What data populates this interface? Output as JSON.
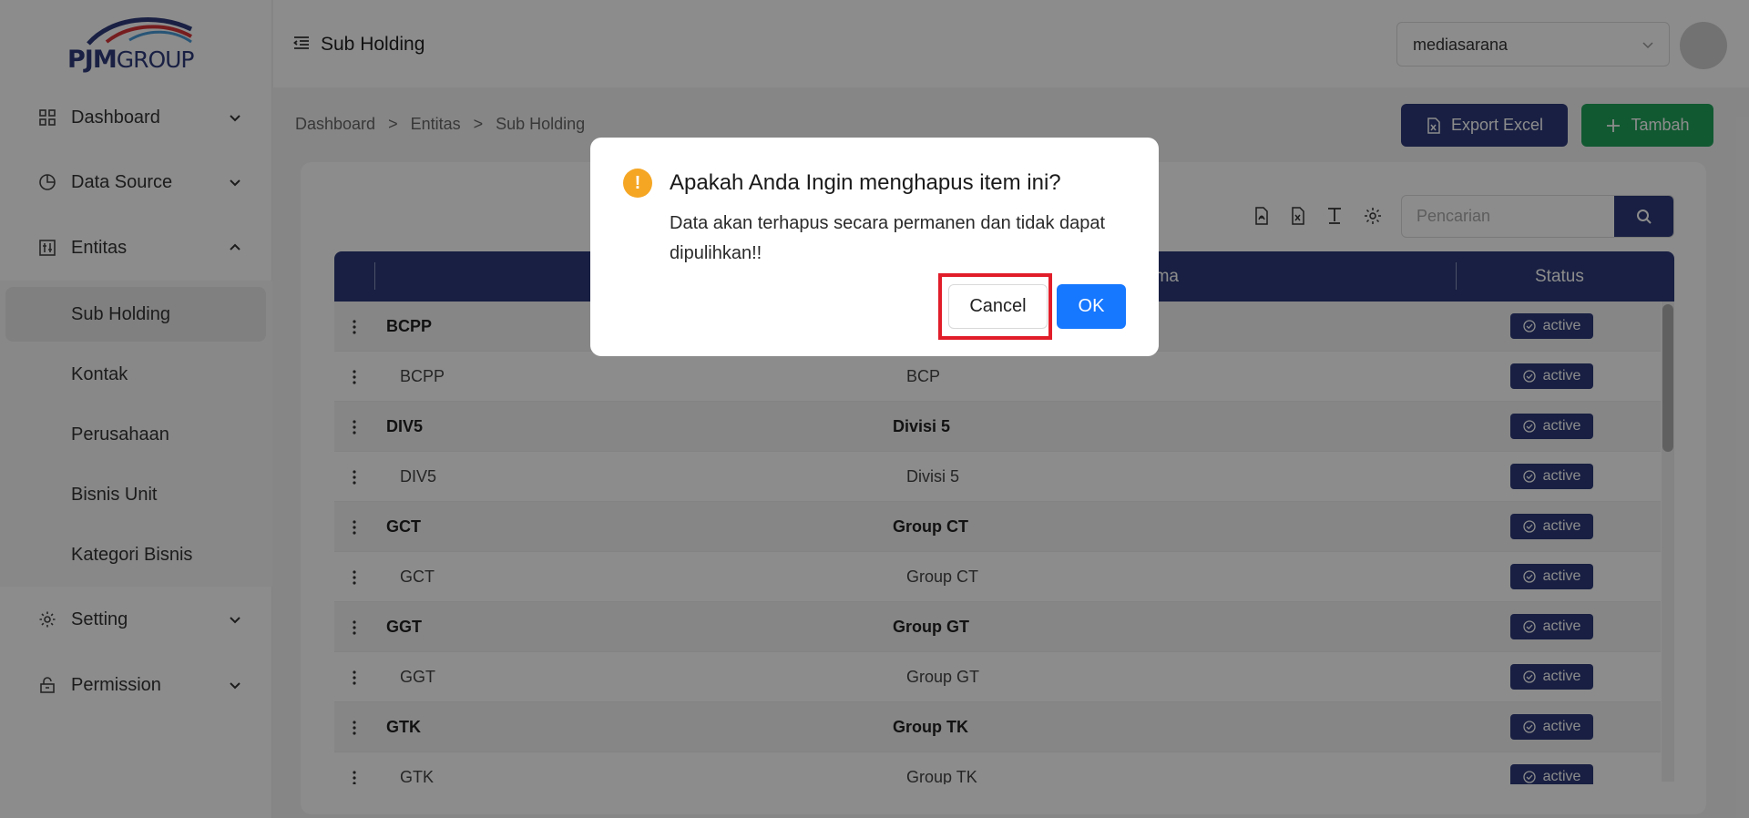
{
  "logo": {
    "text_main": "PJM",
    "text_sub": "GROUP"
  },
  "sidebar": {
    "items": [
      {
        "label": "Dashboard",
        "icon": "dashboard-grid-icon"
      },
      {
        "label": "Data Source",
        "icon": "pie-chart-icon"
      },
      {
        "label": "Entitas",
        "icon": "sliders-icon"
      },
      {
        "label": "Setting",
        "icon": "gear-icon"
      },
      {
        "label": "Permission",
        "icon": "unlock-icon"
      }
    ],
    "entitas_sub": [
      "Sub Holding",
      "Kontak",
      "Perusahaan",
      "Bisnis Unit",
      "Kategori Bisnis"
    ],
    "active_sub": "Sub Holding"
  },
  "header": {
    "title": "Sub Holding",
    "company_select": "mediasarana"
  },
  "breadcrumb": [
    "Dashboard",
    ">",
    "Entitas",
    ">",
    "Sub Holding"
  ],
  "actions": {
    "export_label": "Export Excel",
    "add_label": "Tambah"
  },
  "search": {
    "placeholder": "Pencarian"
  },
  "table": {
    "columns": [
      "ama",
      "Status"
    ],
    "rows": [
      {
        "type": "parent",
        "code": "BCPP",
        "name": "",
        "status": "active"
      },
      {
        "type": "child",
        "code": "BCPP",
        "name": "BCP",
        "status": "active"
      },
      {
        "type": "parent",
        "code": "DIV5",
        "name": "Divisi 5",
        "status": "active"
      },
      {
        "type": "child",
        "code": "DIV5",
        "name": "Divisi 5",
        "status": "active"
      },
      {
        "type": "parent",
        "code": "GCT",
        "name": "Group CT",
        "status": "active"
      },
      {
        "type": "child",
        "code": "GCT",
        "name": "Group CT",
        "status": "active"
      },
      {
        "type": "parent",
        "code": "GGT",
        "name": "Group GT",
        "status": "active"
      },
      {
        "type": "child",
        "code": "GGT",
        "name": "Group GT",
        "status": "active"
      },
      {
        "type": "parent",
        "code": "GTK",
        "name": "Group TK",
        "status": "active"
      },
      {
        "type": "child",
        "code": "GTK",
        "name": "Group TK",
        "status": "active"
      }
    ]
  },
  "dialog": {
    "title": "Apakah Anda Ingin menghapus item ini?",
    "message": "Data akan terhapus secara permanen dan tidak dapat dipulihkan!!",
    "cancel_label": "Cancel",
    "ok_label": "OK"
  },
  "colors": {
    "primary": "#2d3a78",
    "success": "#20a35a",
    "ok_blue": "#1677ff",
    "warning": "#f5a623",
    "highlight_red": "#e11d2a"
  }
}
